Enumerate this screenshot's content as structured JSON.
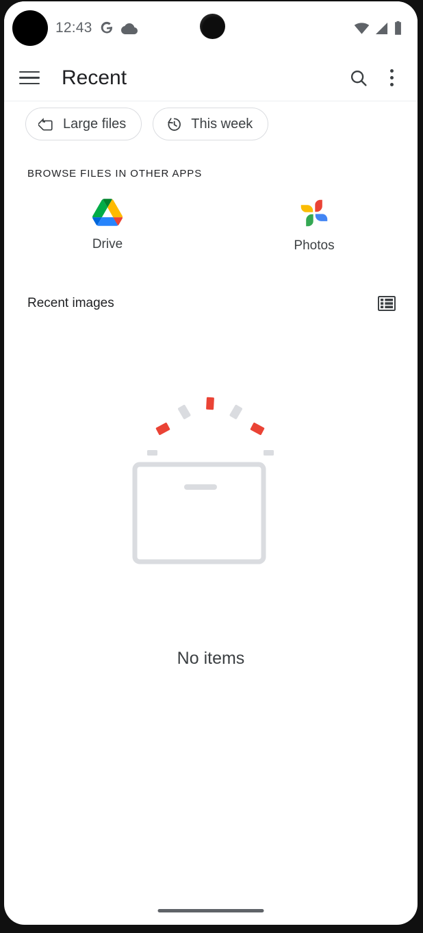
{
  "status_bar": {
    "time": "12:43",
    "notification_icons": [
      "notification-blob",
      "google-g-icon",
      "cloud-icon"
    ],
    "system_icons": [
      "wifi-icon",
      "cell-signal-icon",
      "battery-icon"
    ]
  },
  "app_bar": {
    "menu_icon": "hamburger-menu-icon",
    "title": "Recent",
    "search_icon": "search-icon",
    "overflow_icon": "overflow-menu-icon"
  },
  "chips": [
    {
      "label": "Large files",
      "icon": "tag-icon"
    },
    {
      "label": "This week",
      "icon": "history-icon"
    }
  ],
  "browse_section": {
    "header": "BROWSE FILES IN OTHER APPS",
    "apps": [
      {
        "label": "Drive",
        "icon": "google-drive-icon"
      },
      {
        "label": "Photos",
        "icon": "google-photos-icon"
      }
    ]
  },
  "recent_images": {
    "title": "Recent images",
    "view_toggle_icon": "list-view-icon"
  },
  "empty_state": {
    "illustration": "empty-box-with-confetti",
    "message": "No items"
  },
  "navigation": {
    "gesture_bar": "home-gesture-bar"
  },
  "colors": {
    "accent_red": "#EA4335",
    "accent_blue": "#4285F4",
    "accent_green": "#34A853",
    "accent_yellow": "#FBBC04",
    "text_primary": "#202124",
    "text_secondary": "#3C4043",
    "illustration_grey": "#DADCE0",
    "divider": "#ECEFF1"
  }
}
